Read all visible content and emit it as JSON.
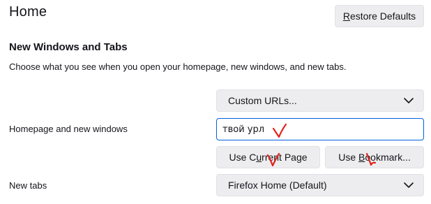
{
  "page": {
    "title": "Home",
    "restore_defaults": {
      "pre": "",
      "accel": "R",
      "post": "estore Defaults"
    }
  },
  "section": {
    "heading": "New Windows and Tabs",
    "description": "Choose what you see when you open your homepage, new windows, and new tabs."
  },
  "homepage": {
    "label": "Homepage and new windows",
    "select_value": "Custom URLs...",
    "url_value": "твой урл",
    "use_current_page": {
      "pre": "Use C",
      "accel": "u",
      "post": "rrent Page"
    },
    "use_bookmark": {
      "pre": "Use ",
      "accel": "B",
      "post": "ookmark..."
    }
  },
  "new_tabs": {
    "label": "New tabs",
    "select_value": "Firefox Home (Default)"
  },
  "colors": {
    "focus_border": "#0061e0",
    "button_bg": "#ededf0",
    "annotation_red": "#e2231a"
  },
  "icons": [
    "chevron-down-icon",
    "checkmark-annotation"
  ]
}
